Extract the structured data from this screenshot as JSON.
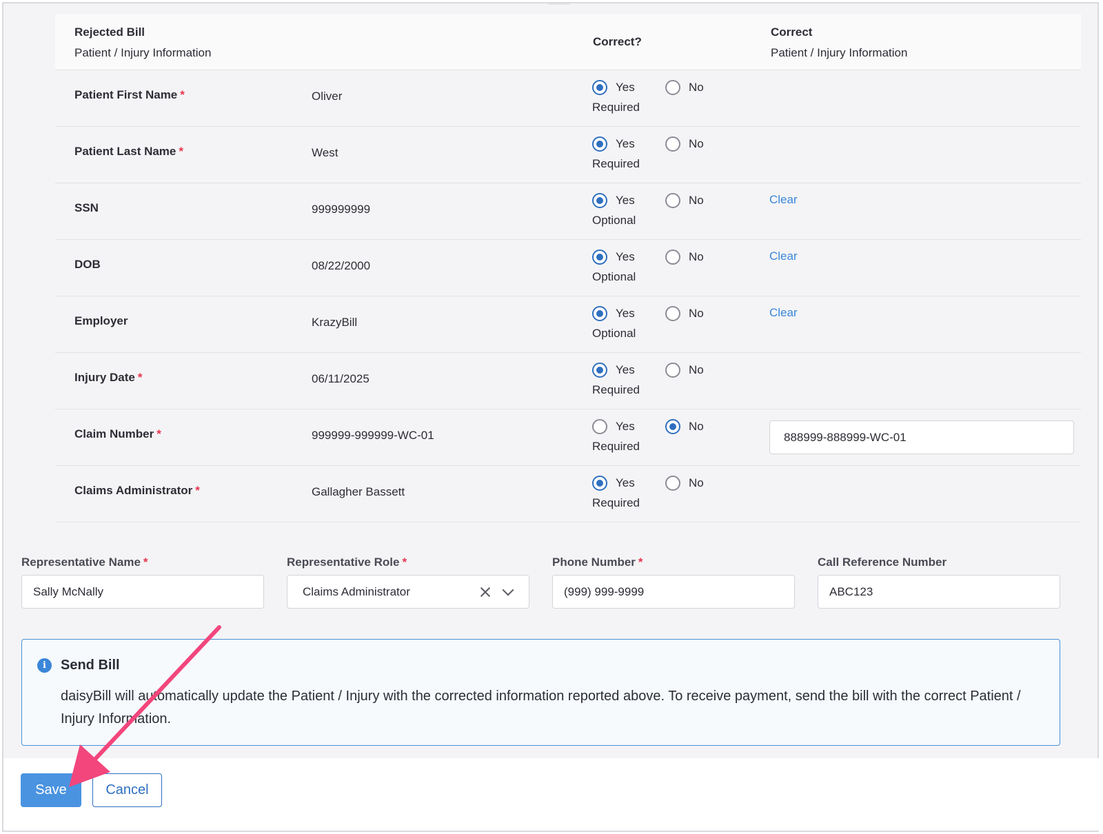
{
  "table": {
    "header": {
      "rejected_title": "Rejected Bill",
      "rejected_sub": "Patient / Injury Information",
      "correct_question": "Correct?",
      "correct_title": "Correct",
      "correct_sub": "Patient / Injury Information"
    },
    "yes_label": "Yes",
    "no_label": "No",
    "clear_label": "Clear",
    "rows": [
      {
        "label": "Patient First Name",
        "required": true,
        "value": "Oliver",
        "selected": "yes",
        "status": "Required",
        "clear": false
      },
      {
        "label": "Patient Last Name",
        "required": true,
        "value": "West",
        "selected": "yes",
        "status": "Required",
        "clear": false
      },
      {
        "label": "SSN",
        "required": false,
        "value": "999999999",
        "selected": "yes",
        "status": "Optional",
        "clear": true
      },
      {
        "label": "DOB",
        "required": false,
        "value": "08/22/2000",
        "selected": "yes",
        "status": "Optional",
        "clear": true
      },
      {
        "label": "Employer",
        "required": false,
        "value": "KrazyBill",
        "selected": "yes",
        "status": "Optional",
        "clear": true
      },
      {
        "label": "Injury Date",
        "required": true,
        "value": "06/11/2025",
        "selected": "yes",
        "status": "Required",
        "clear": false
      },
      {
        "label": "Claim Number",
        "required": true,
        "value": "999999-999999-WC-01",
        "selected": "no",
        "status": "Required",
        "clear": false,
        "correct_value": "888999-888999-WC-01"
      },
      {
        "label": "Claims Administrator",
        "required": true,
        "value": "Gallagher Bassett",
        "selected": "yes",
        "status": "Required",
        "clear": false
      }
    ]
  },
  "representative": {
    "name_label": "Representative Name",
    "name_value": "Sally McNally",
    "role_label": "Representative Role",
    "role_value": "Claims Administrator",
    "phone_label": "Phone Number",
    "phone_value": "(999) 999-9999",
    "callref_label": "Call Reference Number",
    "callref_value": "ABC123"
  },
  "info": {
    "icon": "info-icon",
    "title": "Send Bill",
    "text": "daisyBill will automatically update the Patient / Injury with the corrected information reported above. To receive payment, send the bill with the correct Patient / Injury Information."
  },
  "footer": {
    "save_label": "Save",
    "cancel_label": "Cancel"
  },
  "colors": {
    "accent": "#2f6fc0",
    "link": "#3a86d8",
    "required_star": "#e8364e",
    "annotation_arrow": "#f2467c"
  }
}
